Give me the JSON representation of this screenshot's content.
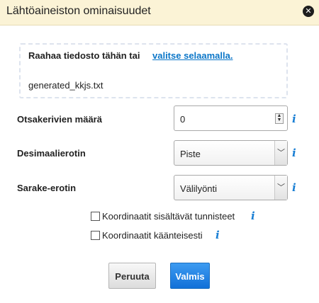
{
  "dialog": {
    "title": "Lähtöaineiston ominaisuudet",
    "close_icon": "close-icon"
  },
  "dropzone": {
    "text": "Raahaa tiedosto tähän tai",
    "link": "valitse selaamalla.",
    "filename": "generated_kkjs.txt"
  },
  "form": {
    "header_rows": {
      "label": "Otsakerivien määrä",
      "value": "0"
    },
    "decimal_separator": {
      "label": "Desimaalierotin",
      "value": "Piste"
    },
    "column_separator": {
      "label": "Sarake-erotin",
      "value": "Välilyönti"
    },
    "checkbox_ids": {
      "label": "Koordinaatit sisältävät tunnisteet",
      "checked": false
    },
    "checkbox_reverse": {
      "label": "Koordinaatit käänteisesti",
      "checked": false
    },
    "info_symbol": "i"
  },
  "buttons": {
    "cancel": "Peruuta",
    "ok": "Valmis"
  },
  "colors": {
    "titlebar": "#fbf3d6",
    "link": "#0b76c8",
    "info": "#1a7fd4",
    "primary": "#1170d8"
  }
}
